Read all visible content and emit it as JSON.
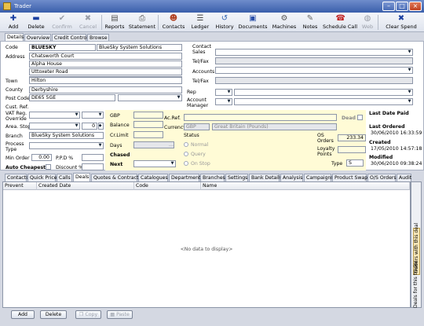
{
  "window": {
    "title": "Trader"
  },
  "toolbar": {
    "add": "Add",
    "delete": "Delete",
    "confirm": "Confirm",
    "cancel": "Cancel",
    "reports": "Reports",
    "statement": "Statement",
    "contacts": "Contacts",
    "ledger": "Ledger",
    "history": "History",
    "documents": "Documents",
    "machines": "Machines",
    "notes": "Notes",
    "schedule_call": "Schedule Call",
    "web": "Web",
    "clear_spend": "Clear Spend"
  },
  "top_tabs": [
    "Details",
    "Overview",
    "Credit Control",
    "Browse"
  ],
  "form": {
    "code_label": "Code",
    "code": "BLUESKY",
    "name": "BlueSky System Solutions",
    "address_label": "Address",
    "address": [
      "Chatsworth Court",
      "Alpha House",
      "Uttoxeter Road",
      ""
    ],
    "town_label": "Town",
    "town": "Hilton",
    "county_label": "County",
    "county": "Derbyshire",
    "postcode_label": "Post Code",
    "postcode": "DE65 5GE",
    "custref_label": "Cust. Ref.",
    "vat_label": "VAT Reg.",
    "override_label": "Override",
    "area_label": "Area. Stop",
    "area_value": "0",
    "branch_label": "Branch",
    "branch": "BlueSky System Solutions",
    "process_label": "Process",
    "type_label": "Type",
    "minorder_label": "Min Order",
    "minorder": "0.00",
    "ppd_label": "P.P.D %",
    "autocheapest_label": "Auto Cheapest",
    "discount_label": "Discount %",
    "contact_label": "Contact",
    "sales_label": "Sales",
    "telfax1_label": "Tel/Fax",
    "accounts_label": "Accounts",
    "telfax2_label": "Tel/Fax",
    "rep_label": "Rep",
    "account_label": "Account",
    "manager_label": "Manager"
  },
  "finance": {
    "gbp_label": "GBP",
    "balance_label": "Balance",
    "crlimit_label": "Cr.Limit",
    "days_label": "Days",
    "chased_label": "Chased",
    "next_label": "Next",
    "acref_label": "Ac.Ref.",
    "dead_label": "Dead",
    "currency_label": "Currency",
    "currency_code": "GBP",
    "currency_name": "Great Britain (Pounds)",
    "status_label": "Status",
    "status_options": [
      "Normal",
      "Query",
      "On Stop"
    ],
    "os_label": "OS",
    "orders_label": "Orders",
    "os_orders": "233.34",
    "loyalty_label": "Loyalty",
    "points_label": "Points",
    "type_label": "Type",
    "type_value": "S"
  },
  "dates": {
    "last_paid_label": "Last Date Paid",
    "last_paid": "",
    "last_ordered_label": "Last Ordered",
    "last_ordered": "30/06/2010 16:33:59",
    "created_label": "Created",
    "created": "17/05/2010 14:57:18",
    "modified_label": "Modified",
    "modified": "30/06/2010 09:38:24"
  },
  "sub_tabs": [
    "Contacts",
    "Quick Price",
    "Calls",
    "Deals",
    "Quotes & Contracts",
    "Catalogues",
    "Departments",
    "Branches",
    "Settings",
    "Bank Details",
    "Analysis",
    "Campaigns",
    "Product Swaps",
    "O/S Orders",
    "Audit"
  ],
  "grid": {
    "columns": [
      "Prevent",
      "Created Date",
      "Code",
      "Name"
    ],
    "empty_text": "<No data to display>"
  },
  "side_tabs": [
    "Traders with this deal",
    "Deals for this trader"
  ],
  "bottom_buttons": {
    "add": "Add",
    "delete": "Delete",
    "copy": "Copy",
    "paste": "Paste"
  }
}
